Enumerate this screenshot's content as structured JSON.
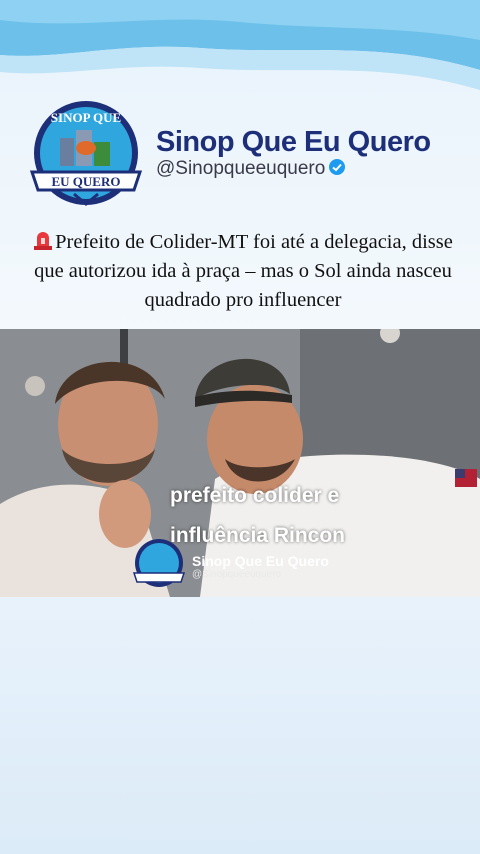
{
  "header": {
    "logo_text_top": "SINOP QUE",
    "logo_text_bottom": "EU QUERO",
    "brand_name": "Sinop Que Eu Quero",
    "handle": "@Sinopqueeuquero"
  },
  "headline": {
    "text": "Prefeito de Colider-MT foi até a delegacia, disse que autorizou ida à praça – mas o Sol ainda nasceu quadrado pro influencer"
  },
  "video": {
    "caption_line1": "prefeito colider  e",
    "caption_line2": "influência Rincon",
    "watermark_name": "Sinop Que Eu Quero",
    "watermark_handle": "@Sinopqueeuquero"
  },
  "colors": {
    "brand_navy": "#1e2f7a",
    "verified_blue": "#1d9bf0",
    "wave_blue": "#5fb8e8"
  }
}
